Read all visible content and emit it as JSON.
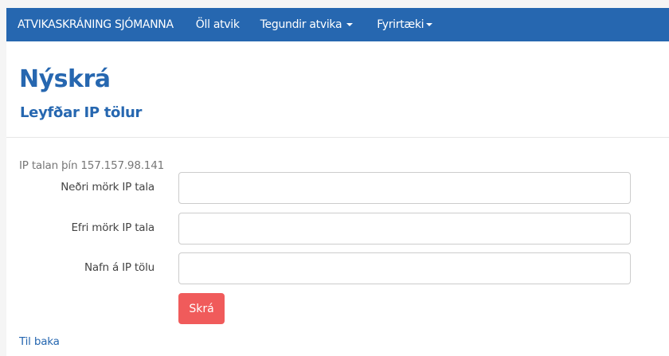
{
  "navbar": {
    "brand": "ATVIKASKRÁNING SJÓMANNA",
    "items": [
      {
        "label": "Öll atvik"
      },
      {
        "label": "Tegundir atvika"
      },
      {
        "label": "Fyrirtæki"
      }
    ]
  },
  "page": {
    "title": "Nýskrá",
    "subtitle": "Leyfðar IP tölur",
    "ip_note": "IP talan þín 157.157.98.141"
  },
  "form": {
    "fields": [
      {
        "label": "Neðri mörk IP tala",
        "value": ""
      },
      {
        "label": "Efri mörk IP tala",
        "value": ""
      },
      {
        "label": "Nafn á IP tölu",
        "value": ""
      }
    ],
    "submit_label": "Skrá"
  },
  "footer": {
    "back_link": "Til baka"
  },
  "colors": {
    "navbar": "#2667b0",
    "accent_text": "#2667b0",
    "submit": "#f05b5b"
  }
}
